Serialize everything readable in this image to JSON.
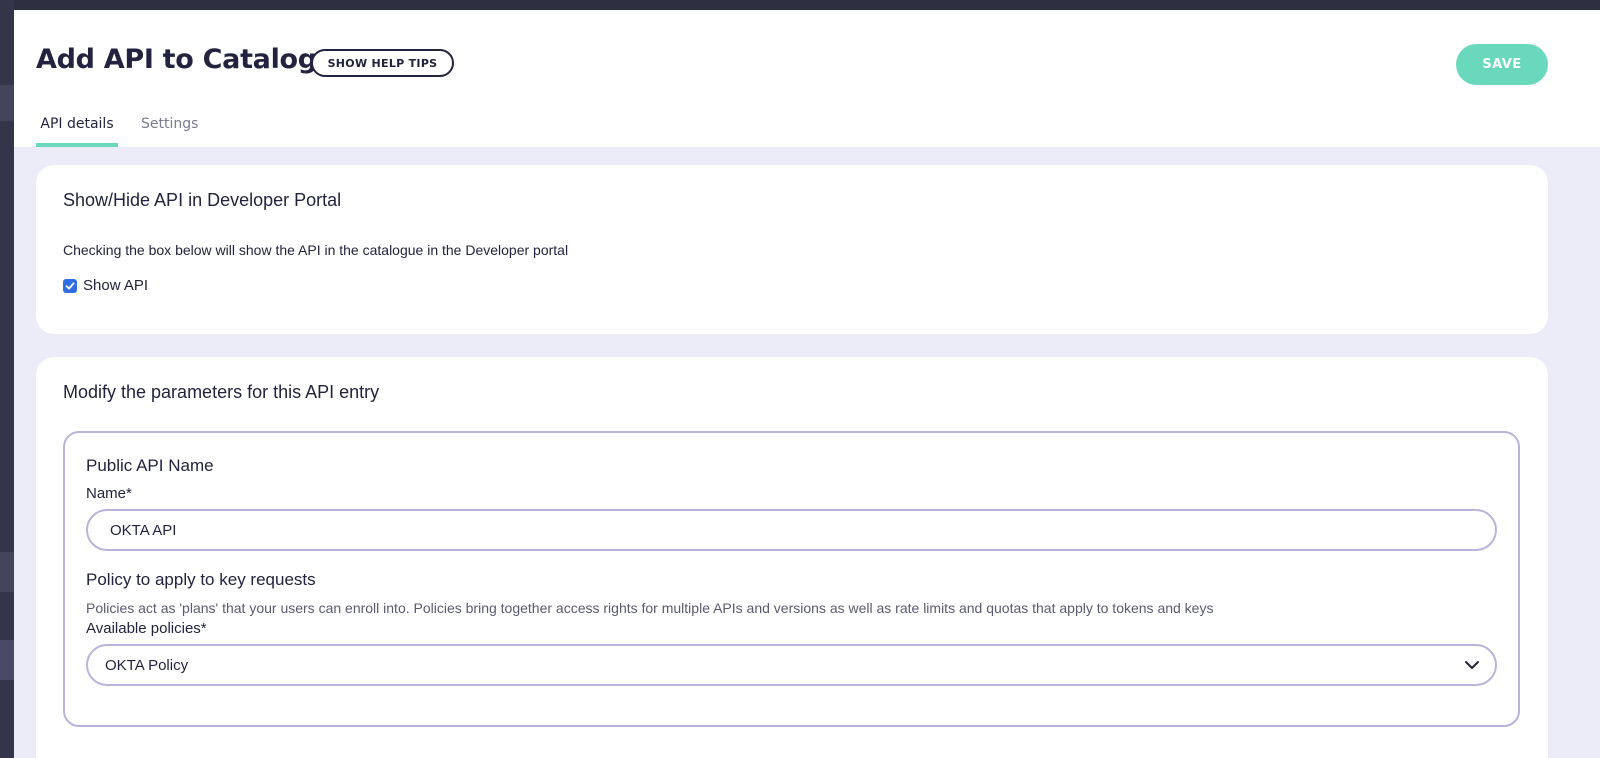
{
  "header": {
    "title": "Add API to Catalogue",
    "help_button_label": "SHOW HELP TIPS",
    "save_button_label": "SAVE"
  },
  "tabs": [
    {
      "label": "API details",
      "active": true
    },
    {
      "label": "Settings",
      "active": false
    }
  ],
  "visibility_card": {
    "title": "Show/Hide API in Developer Portal",
    "description": "Checking the box below will show the API in the catalogue in the Developer portal",
    "checkbox_label": "Show API",
    "checked": true
  },
  "params_card": {
    "title": "Modify the parameters for this API entry",
    "public_name_section": "Public API Name",
    "name_label": "Name*",
    "name_value": "OKTA API",
    "policy_section": "Policy to apply to key requests",
    "policy_help": "Policies act as 'plans' that your users can enroll into. Policies bring together access rights for multiple APIs and versions as well as rate limits and quotas that apply to tokens and keys",
    "policies_label": "Available policies*",
    "policy_selected": "OKTA Policy"
  },
  "colors": {
    "accent": "#6ad8bd",
    "checkbox": "#2f6fe0",
    "border": "#b9b4dc",
    "background": "#ececf8"
  },
  "icons": {
    "checkbox": "checkmark-icon",
    "select": "chevron-down-icon"
  }
}
